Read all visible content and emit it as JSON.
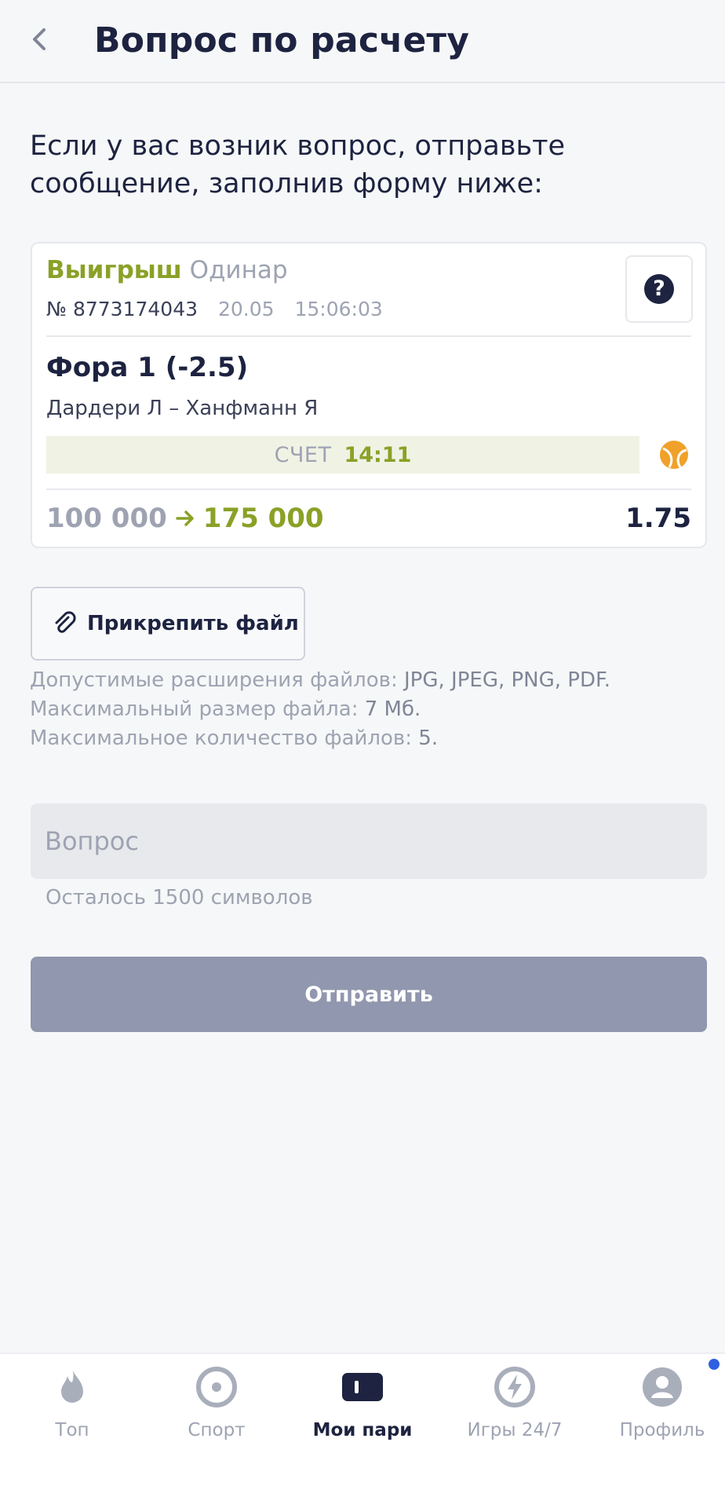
{
  "header": {
    "title": "Вопрос по расчету"
  },
  "intro": {
    "text": "Если у вас возник вопрос, отправьте сообщение, заполнив форму ниже:"
  },
  "bet": {
    "status": "Выигрыш",
    "type": "Одинар",
    "number": "№ 8773174043",
    "date": "20.05",
    "time": "15:06:03",
    "market": "Фора 1 (-2.5)",
    "teams": "Дардери Л – Ханфманн Я",
    "score_label": "СЧЕТ",
    "score_value": "14:11",
    "stake": "100 000",
    "payout": "175 000",
    "odds": "1.75",
    "help_symbol": "?",
    "sport_icon": "tennis-ball-icon"
  },
  "attach": {
    "label": "Прикрепить файл",
    "rule1_prefix": "Допустимые расширения файлов: ",
    "rule1_value": "JPG, JPEG, PNG, PDF.",
    "rule2_prefix": "Максимальный размер файла: ",
    "rule2_value": "7 Мб.",
    "rule3_prefix": "Максимальное количество файлов: ",
    "rule3_value": "5."
  },
  "question": {
    "placeholder": "Вопрос",
    "value": "",
    "chars_left": "Осталось 1500 символов"
  },
  "submit": {
    "label": "Отправить"
  },
  "tabs": [
    {
      "label": "Топ",
      "icon": "flame-icon",
      "active": false
    },
    {
      "label": "Спорт",
      "icon": "target-icon",
      "active": false
    },
    {
      "label": "Мои пари",
      "icon": "ticket-icon",
      "active": true
    },
    {
      "label": "Игры 24/7",
      "icon": "lightning-icon",
      "active": false
    },
    {
      "label": "Профиль",
      "icon": "profile-icon",
      "active": false
    }
  ],
  "colors": {
    "accent_green": "#8aa127",
    "dark": "#1d2340",
    "muted": "#9ea3b2",
    "button": "#9097ae",
    "notification": "#2f5fe0"
  }
}
